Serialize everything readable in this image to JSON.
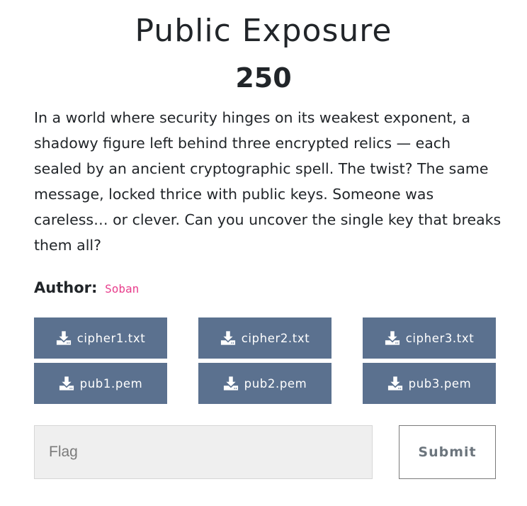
{
  "challenge": {
    "title": "Public Exposure",
    "points": "250",
    "description": "In a world where security hinges on its weakest exponent, a shadowy figure left behind three encrypted relics — each sealed by an ancient cryptographic spell. The twist? The same message, locked thrice with public keys. Someone was careless… or clever. Can you uncover the single key that breaks them all?",
    "author_label": "Author:",
    "author_name": "Soban"
  },
  "files": [
    {
      "label": "cipher1.txt",
      "icon": "download-icon"
    },
    {
      "label": "cipher2.txt",
      "icon": "download-icon"
    },
    {
      "label": "cipher3.txt",
      "icon": "download-icon"
    },
    {
      "label": "pub1.pem",
      "icon": "download-icon"
    },
    {
      "label": "pub2.pem",
      "icon": "download-icon"
    },
    {
      "label": "pub3.pem",
      "icon": "download-icon"
    }
  ],
  "flag_form": {
    "placeholder": "Flag",
    "value": "",
    "submit_label": "Submit"
  },
  "colors": {
    "file_button_bg": "#5b718f",
    "author_name": "#e83e8c",
    "input_bg": "#efefef"
  }
}
